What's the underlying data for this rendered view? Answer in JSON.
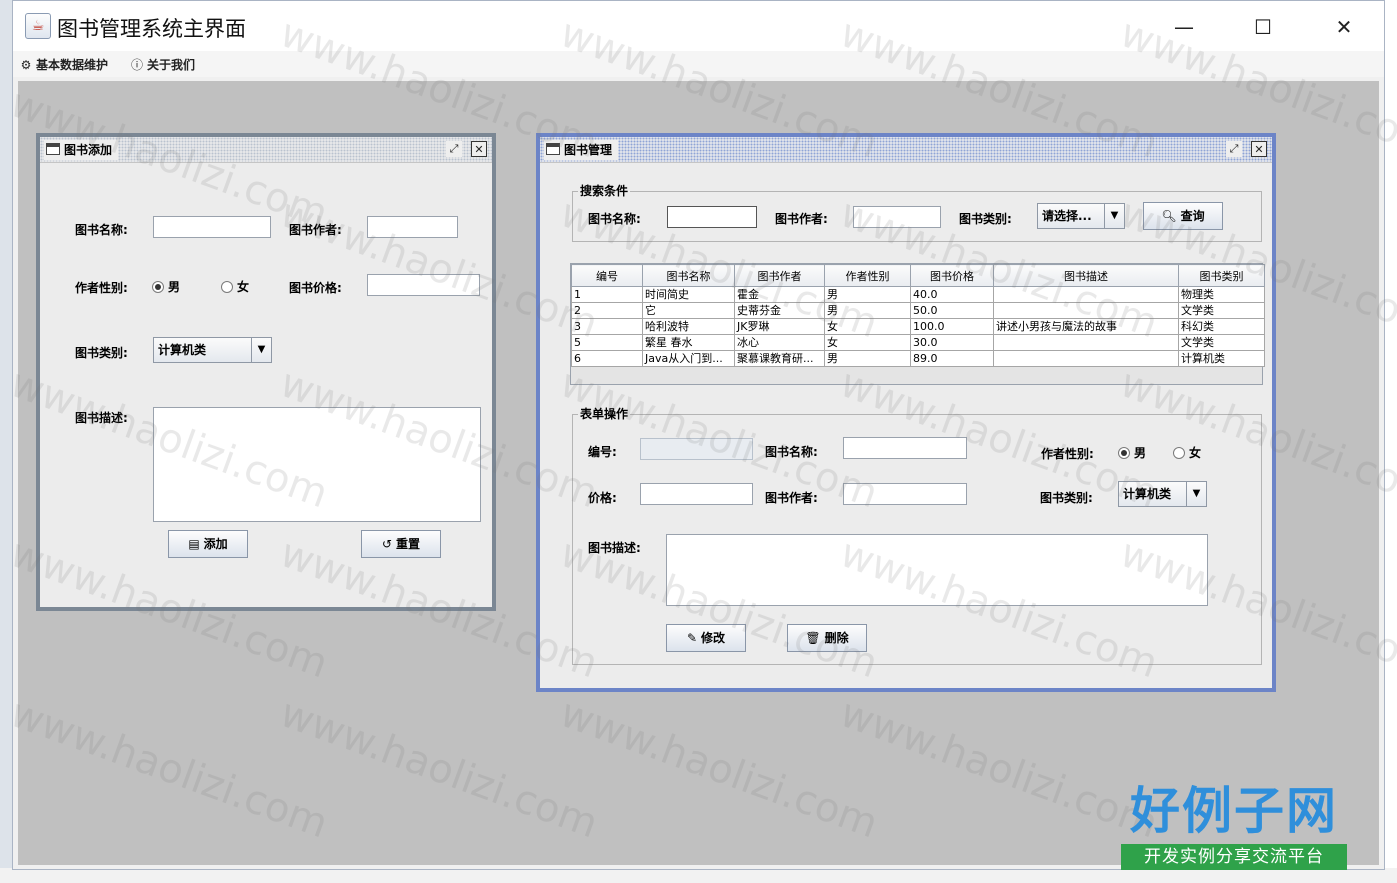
{
  "window": {
    "title": "图书管理系统主界面",
    "controls": {
      "minimize": "—",
      "maximize": "☐",
      "close": "✕"
    }
  },
  "menubar": {
    "items": [
      {
        "label": "基本数据维护",
        "icon": "gear-icon"
      },
      {
        "label": "关于我们",
        "icon": "info-icon"
      }
    ]
  },
  "book_add": {
    "title": "图书添加",
    "name_label": "图书名称:",
    "name_value": "",
    "author_label": "图书作者:",
    "author_value": "",
    "gender_label": "作者性别:",
    "gender_options": [
      "男",
      "女"
    ],
    "gender_selected": "男",
    "price_label": "图书价格:",
    "price_value": "",
    "type_label": "图书类别:",
    "type_value": "计算机类",
    "desc_label": "图书描述:",
    "desc_value": "",
    "add_button": "添加",
    "reset_button": "重置"
  },
  "book_manage": {
    "title": "图书管理",
    "search": {
      "group_title": "搜索条件",
      "name_label": "图书名称:",
      "name_value": "",
      "author_label": "图书作者:",
      "author_value": "",
      "type_label": "图书类别:",
      "type_value": "请选择...",
      "query_button": "查询"
    },
    "table": {
      "columns": [
        "编号",
        "图书名称",
        "图书作者",
        "作者性别",
        "图书价格",
        "图书描述",
        "图书类别"
      ],
      "rows": [
        [
          "1",
          "时间简史",
          "霍金",
          "男",
          "40.0",
          "",
          "物理类"
        ],
        [
          "2",
          "它",
          "史蒂芬金",
          "男",
          "50.0",
          "",
          "文学类"
        ],
        [
          "3",
          "哈利波特",
          "JK罗琳",
          "女",
          "100.0",
          "讲述小男孩与魔法的故事",
          "科幻类"
        ],
        [
          "5",
          "繁星 春水",
          "冰心",
          "女",
          "30.0",
          "",
          "文学类"
        ],
        [
          "6",
          "Java从入门到...",
          "聚慕课教育研...",
          "男",
          "89.0",
          "",
          "计算机类"
        ]
      ]
    },
    "form": {
      "group_title": "表单操作",
      "id_label": "编号:",
      "id_value": "",
      "name_label": "图书名称:",
      "name_value": "",
      "gender_label": "作者性别:",
      "gender_options": [
        "男",
        "女"
      ],
      "gender_selected": "男",
      "price_label": "价格:",
      "price_value": "",
      "author_label": "图书作者:",
      "author_value": "",
      "type_label": "图书类别:",
      "type_value": "计算机类",
      "desc_label": "图书描述:",
      "desc_value": "",
      "modify_button": "修改",
      "delete_button": "删除"
    }
  },
  "watermark": "www.haolizi.com",
  "logo": {
    "main": "好例子网",
    "sub": "开发实例分享交流平台"
  }
}
